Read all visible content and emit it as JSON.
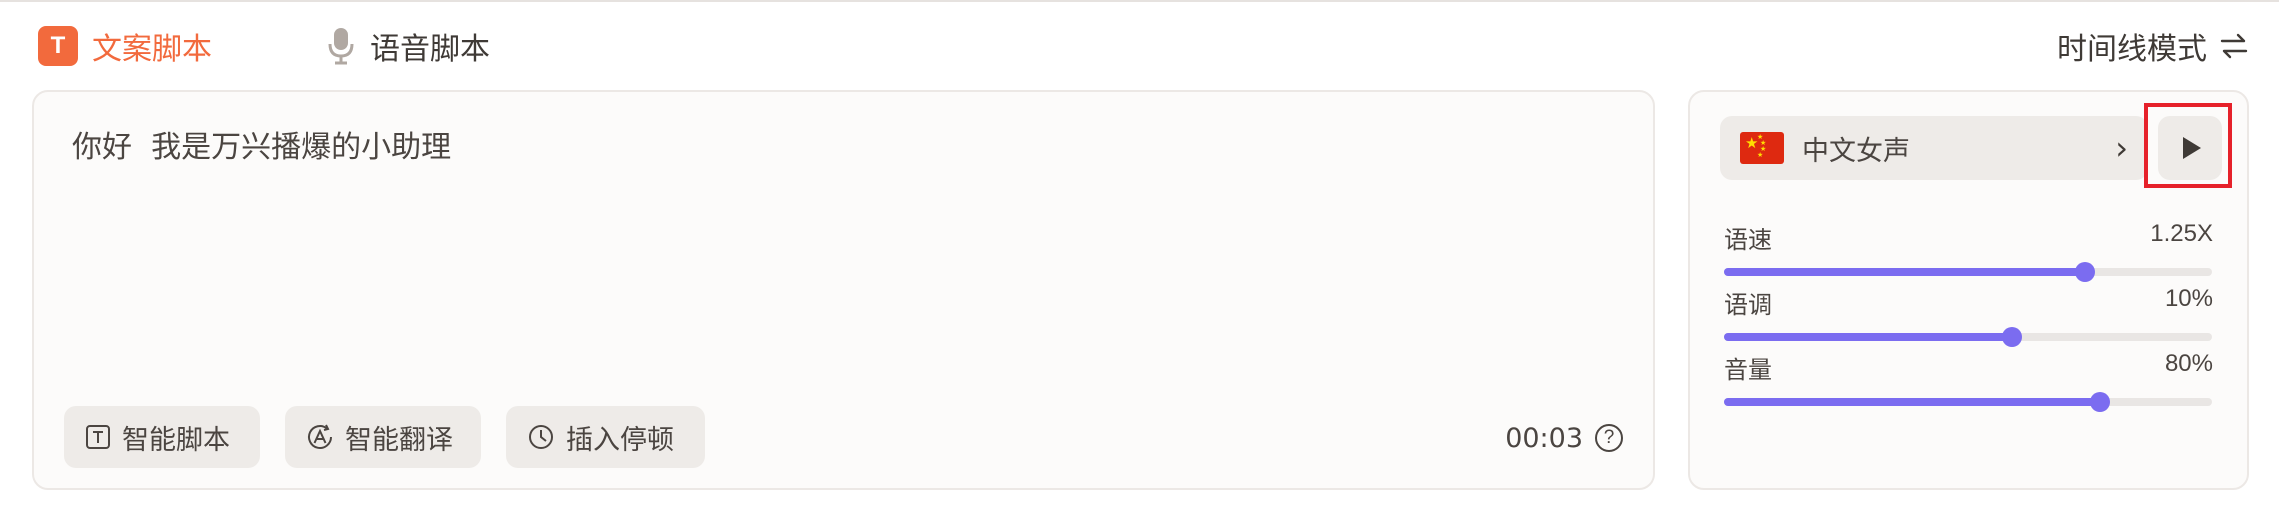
{
  "tabs": {
    "script_tab": {
      "badge": "T",
      "label": "文案脚本"
    },
    "voice_tab": {
      "label": "语音脚本"
    },
    "mode_toggle": {
      "label": "时间线模式",
      "icon": "swap-arrows-icon"
    }
  },
  "editor": {
    "script_text": "你好  我是万兴播爆的小助理",
    "tools": [
      {
        "label": "智能脚本",
        "icon": "text-box-icon"
      },
      {
        "label": "智能翻译",
        "icon": "translate-icon"
      },
      {
        "label": "插入停顿",
        "icon": "clock-icon"
      }
    ],
    "duration": "00:03",
    "help_icon": "?"
  },
  "voice_panel": {
    "voice": {
      "name": "中文女声",
      "flag": "china-flag-icon"
    },
    "play_button": {
      "icon": "play-icon",
      "highlighted": true,
      "highlight_color": "#e6212a"
    },
    "sliders": [
      {
        "label": "语速",
        "value_text": "1.25X",
        "fraction": 0.74
      },
      {
        "label": "语调",
        "value_text": "10%",
        "fraction": 0.59
      },
      {
        "label": "音量",
        "value_text": "80%",
        "fraction": 0.77
      }
    ]
  },
  "colors": {
    "accent": "#f26a3d",
    "slider": "#7b6cf0",
    "text": "#3f3a36"
  }
}
